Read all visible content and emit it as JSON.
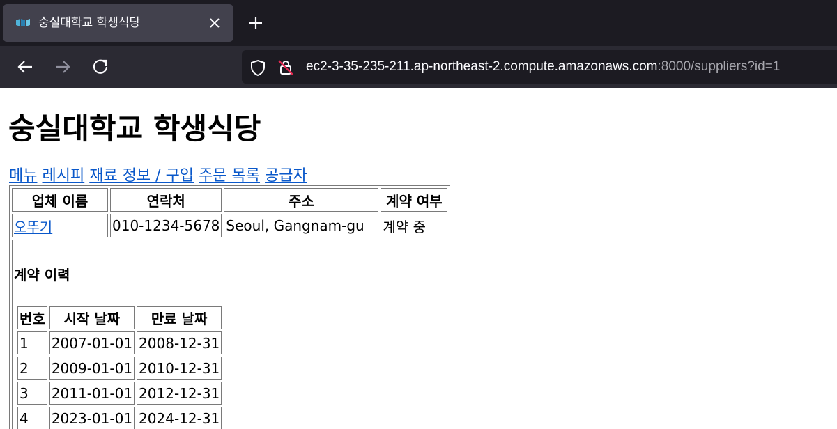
{
  "browser": {
    "tab_title": "숭실대학교 학생식당",
    "url_host": "ec2-3-35-235-211.ap-northeast-2.compute.amazonaws.com",
    "url_path": ":8000/suppliers?id=1",
    "icons": [
      "favicon",
      "close-icon",
      "plus-icon",
      "back-arrow-icon",
      "forward-arrow-icon",
      "reload-icon",
      "shield-icon",
      "insecure-lock-icon"
    ]
  },
  "page": {
    "title": "숭실대학교 학생식당",
    "nav": [
      "메뉴",
      "레시피",
      "재료 정보 / 구입",
      "주문 목록",
      "공급자"
    ],
    "suppliers_table": {
      "headers": [
        "업체 이름",
        "연락처",
        "주소",
        "계약 여부"
      ],
      "row": {
        "name": "오뚜기",
        "contact": "010-1234-5678",
        "address": "Seoul, Gangnam-gu",
        "status": "계약 중"
      }
    },
    "history": {
      "title": "계약 이력",
      "headers": [
        "번호",
        "시작 날짜",
        "만료 날짜"
      ],
      "rows": [
        [
          "1",
          "2007-01-01",
          "2008-12-31"
        ],
        [
          "2",
          "2009-01-01",
          "2010-12-31"
        ],
        [
          "3",
          "2011-01-01",
          "2012-12-31"
        ],
        [
          "4",
          "2023-01-01",
          "2024-12-31"
        ]
      ]
    }
  },
  "colors": {
    "link": "#0a58ca",
    "tabbar": "#1c1b22",
    "active_tab": "#42414d",
    "navbar": "#2b2a33"
  }
}
